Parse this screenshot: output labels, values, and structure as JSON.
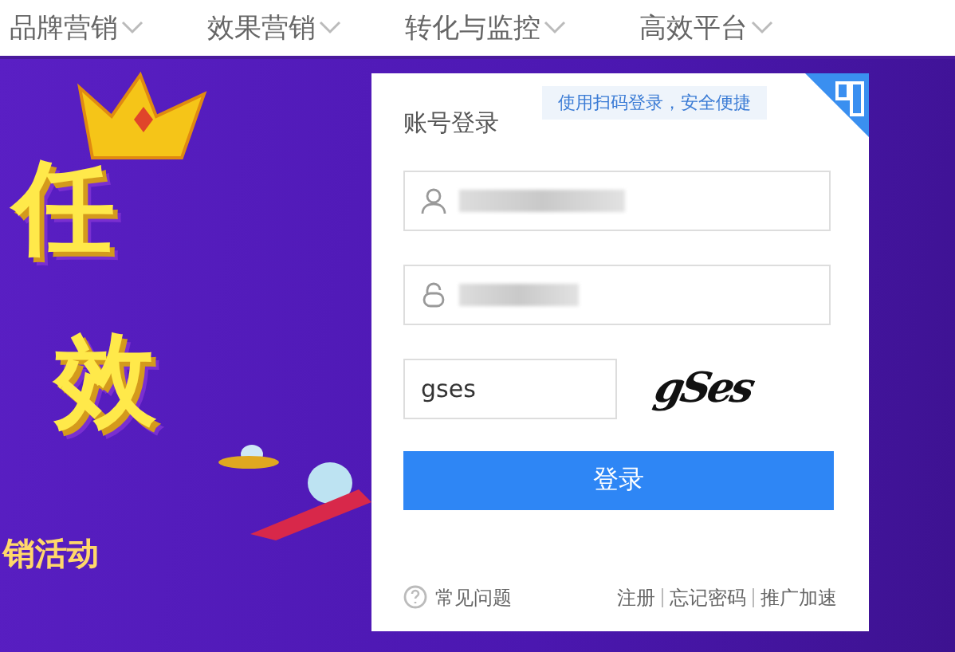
{
  "nav": {
    "items": [
      {
        "label": "品牌营销"
      },
      {
        "label": "效果营销"
      },
      {
        "label": "转化与监控"
      },
      {
        "label": "高效平台"
      }
    ]
  },
  "banner": {
    "lines": [
      "任",
      "效",
      "销活动"
    ]
  },
  "login": {
    "title": "账号登录",
    "qr_tip": "使用扫码登录，安全便捷",
    "captcha": {
      "value": "gses",
      "image_text": "gSes"
    },
    "submit": "登录",
    "help": "常见问题",
    "links": [
      {
        "label": "注册"
      },
      {
        "label": "忘记密码"
      },
      {
        "label": "推广加速"
      }
    ]
  }
}
